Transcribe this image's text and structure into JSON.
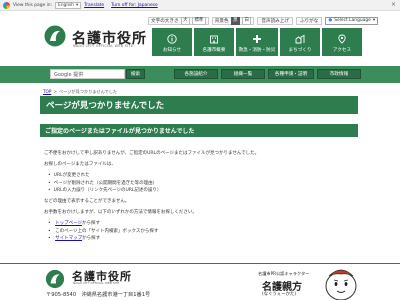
{
  "translate_bar": {
    "view_label": "View this page in:",
    "language": "English",
    "translate_link": "Translate",
    "turn_off": "Turn off for: Japanese",
    "close": "×"
  },
  "header": {
    "title": "名護市役所",
    "subtitle": "NAGO CITY OFFICIAL WEB SITE",
    "font_size_label": "文字の大きさ",
    "font_larger": "大",
    "font_normal": "標準",
    "bg_label": "背景色",
    "bg_black": "黒",
    "bg_white": "白",
    "read_aloud": "音声読み上げ",
    "furigana": "ふりがな",
    "lang_select": "Select Language"
  },
  "nav": {
    "items": [
      {
        "label": "お知らせ",
        "icon": "info-icon"
      },
      {
        "label": "名護市概要",
        "icon": "building-icon"
      },
      {
        "label": "救急・消防・防災",
        "icon": "emergency-icon"
      },
      {
        "label": "まちづくり",
        "icon": "town-icon"
      },
      {
        "label": "アクセス",
        "icon": "access-icon"
      }
    ]
  },
  "search": {
    "placeholder": "Google 提供",
    "button": "検索",
    "links": [
      "各施設紹介",
      "組織一覧",
      "各種申請・証明",
      "市政情報"
    ]
  },
  "breadcrumb": {
    "home": "TOP",
    "separator": ">",
    "current": "ページが見つかりませんでした"
  },
  "page": {
    "title": "ページが見つかりませんでした",
    "section_title": "ご指定のページまたはファイルが見つかりませんでした",
    "p1": "ご不便をおかけして申し訳ありませんが、ご指定のURLのページまたはファイルが見つかりませんでした。",
    "p2": "お探しのページまたはファイルは、",
    "reasons": [
      "URLが変更された",
      "ページが削除された（公開期間を過ぎた等の理由）",
      "URLの入力誤り（リンク先ページのURL記述の誤り）"
    ],
    "p3": "などの理由で表示することができません。",
    "p4": "お手数をおかけしますが、以下のいずれかの方法で情報をお探しください。",
    "options": [
      {
        "link": "トップページ",
        "rest": "から探す"
      },
      {
        "link": "",
        "rest": "このページ上の「サイト内検索」ボックスから探す"
      },
      {
        "link": "サイトマップ",
        "rest": "から探す"
      }
    ]
  },
  "footer": {
    "title": "名護市役所",
    "subtitle": "NAGO CITY OFFICIAL WEB SITE",
    "address": "〒905-8540　沖縄県名護市港一丁目1番1号",
    "mascot_caption": "名護市PR公認キャラクター",
    "mascot_name": "名護親方",
    "mascot_reading": "(なぐうぇーかた)"
  },
  "colors": {
    "primary_green": "#2e7d4f",
    "band_green": "#3d8c5e",
    "link_blue": "#1a0dab"
  }
}
